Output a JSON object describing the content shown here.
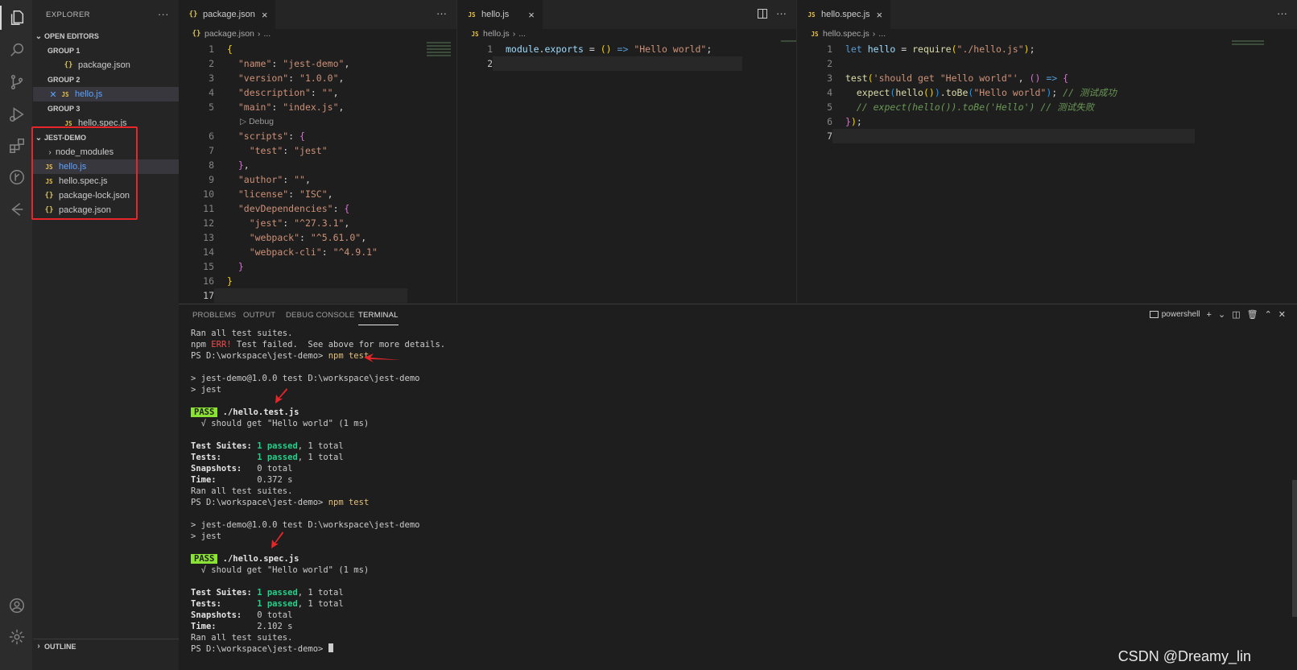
{
  "activity_bar": {
    "items": [
      "files-icon",
      "search-icon",
      "source-control-icon",
      "run-debug-icon",
      "extensions-icon",
      "git-history-icon",
      "remote-icon"
    ],
    "bottom": [
      "account-icon",
      "settings-icon"
    ]
  },
  "sidebar": {
    "title": "EXPLORER",
    "more": "···",
    "open_editors_label": "OPEN EDITORS",
    "groups": [
      {
        "label": "GROUP 1",
        "file": "package.json",
        "type": "json"
      },
      {
        "label": "GROUP 2",
        "file": "hello.js",
        "type": "js"
      },
      {
        "label": "GROUP 3",
        "file": "hello.spec.js",
        "type": "js"
      }
    ],
    "project_label": "JEST-DEMO",
    "files": [
      {
        "name": "node_modules",
        "type": "folder"
      },
      {
        "name": "hello.js",
        "type": "js"
      },
      {
        "name": "hello.spec.js",
        "type": "js"
      },
      {
        "name": "package-lock.json",
        "type": "json"
      },
      {
        "name": "package.json",
        "type": "json"
      }
    ],
    "outline_label": "OUTLINE"
  },
  "editor1": {
    "tab": "package.json",
    "crumb": "package.json",
    "crumb_more": "...",
    "codelens": "Debug",
    "lines": [
      "1",
      "2",
      "3",
      "4",
      "5",
      "6",
      "7",
      "8",
      "9",
      "10",
      "11",
      "12",
      "13",
      "14",
      "15",
      "16",
      "17"
    ],
    "json": {
      "name_key": "\"name\"",
      "name_val": "\"jest-demo\"",
      "version_key": "\"version\"",
      "version_val": "\"1.0.0\"",
      "description_key": "\"description\"",
      "description_val": "\"\"",
      "main_key": "\"main\"",
      "main_val": "\"index.js\"",
      "scripts_key": "\"scripts\"",
      "test_key": "\"test\"",
      "test_val": "\"jest\"",
      "author_key": "\"author\"",
      "author_val": "\"\"",
      "license_key": "\"license\"",
      "license_val": "\"ISC\"",
      "dev_key": "\"devDependencies\"",
      "jest_key": "\"jest\"",
      "jest_val": "\"^27.3.1\"",
      "webpack_key": "\"webpack\"",
      "webpack_val": "\"^5.61.0\"",
      "webpackcli_key": "\"webpack-cli\"",
      "webpackcli_val": "\"^4.9.1\""
    }
  },
  "editor2": {
    "tab": "hello.js",
    "crumb": "hello.js",
    "crumb_more": "...",
    "lines": [
      "1",
      "2"
    ],
    "code": {
      "obj": "module",
      "prop": "exports",
      "str": "\"Hello world\""
    }
  },
  "editor3": {
    "tab": "hello.spec.js",
    "crumb": "hello.spec.js",
    "crumb_more": "...",
    "lines": [
      "1",
      "2",
      "3",
      "4",
      "5",
      "6",
      "7"
    ],
    "code": {
      "let": "let",
      "var": "hello",
      "require": "require",
      "path": "\"./hello.js\"",
      "test": "test",
      "test_name": "'should get \"Hello world\"'",
      "expect": "expect",
      "hello": "hello",
      "tobe": "toBe",
      "expected": "\"Hello world\"",
      "comment1": "// 测试成功",
      "comment2": "// expect(hello()).toBe('Hello') // 测试失败"
    }
  },
  "panel": {
    "tabs": [
      "PROBLEMS",
      "OUTPUT",
      "DEBUG CONSOLE",
      "TERMINAL"
    ],
    "active_tab": "TERMINAL",
    "shell": "powershell",
    "terminal": {
      "l1": "Ran all test suites.",
      "l2a": "npm ",
      "l2b": "ERR!",
      "l2c": " Test failed.  See above for more details.",
      "prompt": "PS D:\\workspace\\jest-demo> ",
      "cmd": "npm test",
      "run1": "> jest-demo@1.0.0 test D:\\workspace\\jest-demo",
      "run2": "> jest",
      "pass": "PASS",
      "file1": "./hello.test.js",
      "file2": "./hello.spec.js",
      "case": "  √ should get \"Hello world\" (1 ms)",
      "suites_label": "Test Suites:",
      "tests_label": "Tests:",
      "snap_label": "Snapshots:",
      "time_label": "Time:",
      "passed": "1 passed",
      "total": ", 1 total",
      "snap_val": "0 total",
      "time1": "0.372 s",
      "time2": "2.102 s"
    }
  },
  "watermark": "CSDN @Dreamy_lin",
  "colors": {
    "highlight_box": "#e8262a",
    "arrow": "#e8262a"
  }
}
